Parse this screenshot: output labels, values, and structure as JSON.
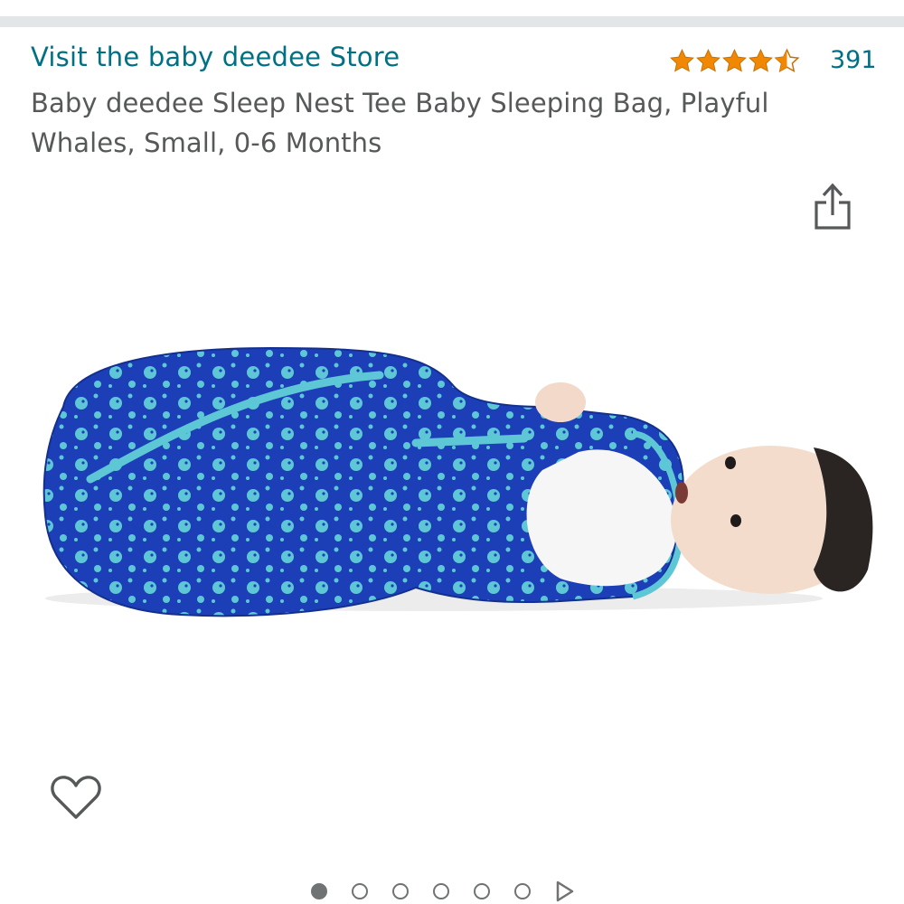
{
  "store": {
    "link_text": "Visit the baby deedee Store"
  },
  "rating": {
    "stars": 4.5,
    "max_stars": 5,
    "count": "391",
    "star_color": "#f08804"
  },
  "product": {
    "title": "Baby deedee Sleep Nest Tee Baby Sleeping Bag, Playful Whales, Small, 0-6 Months",
    "image": {
      "primary_color": "#1c3fb8",
      "accent_color": "#5ec7d6"
    }
  },
  "icons": {
    "share": "share-icon",
    "wishlist": "heart-outline-icon",
    "next": "play-triangle-icon"
  },
  "carousel": {
    "total_images": 6,
    "active_index": 0
  },
  "colors": {
    "link": "#007185",
    "text_secondary": "#565959",
    "divider": "#e3e6e6"
  }
}
